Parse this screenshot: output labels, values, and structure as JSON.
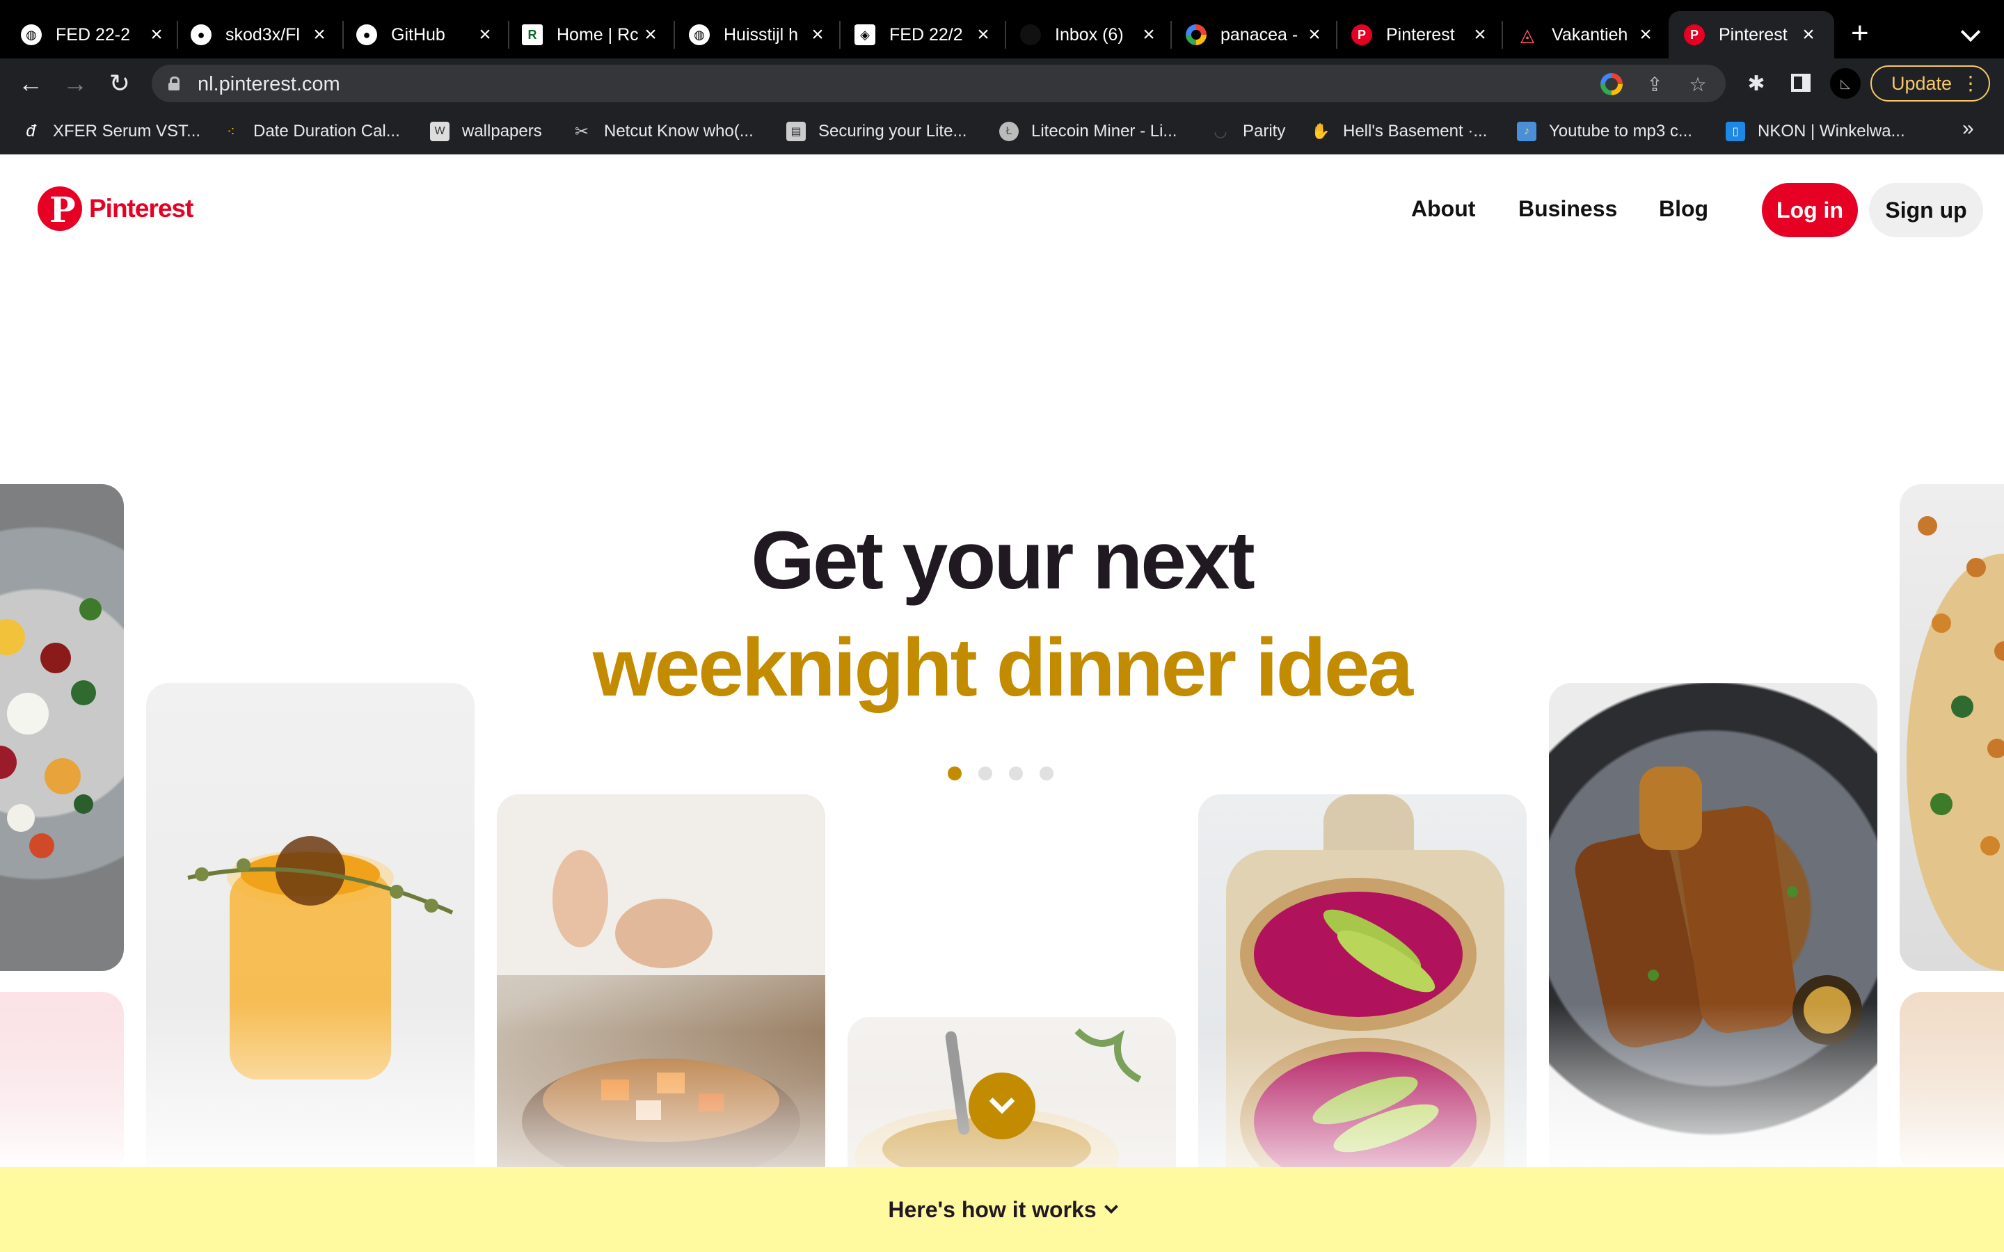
{
  "browser": {
    "tabs": [
      {
        "label": "FED 22-2",
        "icon": "globe-icon"
      },
      {
        "label": "skod3x/Fl",
        "icon": "github-icon"
      },
      {
        "label": "GitHub",
        "icon": "github-icon"
      },
      {
        "label": "Home | Rc",
        "icon": "green-r-icon"
      },
      {
        "label": "Huisstijl h",
        "icon": "globe-icon"
      },
      {
        "label": "FED 22/2",
        "icon": "codepen-icon"
      },
      {
        "label": "Inbox (6)",
        "icon": "mail-icon"
      },
      {
        "label": "panacea -",
        "icon": "google-icon"
      },
      {
        "label": "Pinterest",
        "icon": "pinterest-icon"
      },
      {
        "label": "Vakantieh",
        "icon": "airbnb-icon"
      },
      {
        "label": "Pinterest",
        "icon": "pinterest-icon",
        "active": true
      }
    ],
    "url": "nl.pinterest.com",
    "update_label": "Update",
    "bookmarks": [
      {
        "label": "XFER Serum VST...",
        "icon": "xfer-icon"
      },
      {
        "label": "Date Duration Cal...",
        "icon": "dots-icon"
      },
      {
        "label": "wallpapers",
        "icon": "wallpapers-icon"
      },
      {
        "label": "Netcut Know who(...",
        "icon": "scissors-icon"
      },
      {
        "label": "Securing your Lite...",
        "icon": "doc-icon"
      },
      {
        "label": "Litecoin Miner - Li...",
        "icon": "litecoin-icon"
      },
      {
        "label": "Parity",
        "icon": "parity-icon"
      },
      {
        "label": "Hell's Basement ·...",
        "icon": "hands-icon"
      },
      {
        "label": "Youtube to mp3 c...",
        "icon": "youtube-mp3-icon"
      },
      {
        "label": "NKON | Winkelwa...",
        "icon": "nkon-icon"
      }
    ]
  },
  "header": {
    "logo_text": "Pinterest",
    "nav": [
      "About",
      "Business",
      "Blog"
    ],
    "login_label": "Log in",
    "signup_label": "Sign up"
  },
  "hero": {
    "line1": "Get your next",
    "line2": "weeknight dinner idea",
    "carousel_dots": 4,
    "active_dot": 0
  },
  "footer_bar": {
    "label": "Here's how it works"
  },
  "colors": {
    "brand_red": "#e60023",
    "accent_gold": "#c28b00",
    "banner_yellow": "#fff9a0"
  }
}
